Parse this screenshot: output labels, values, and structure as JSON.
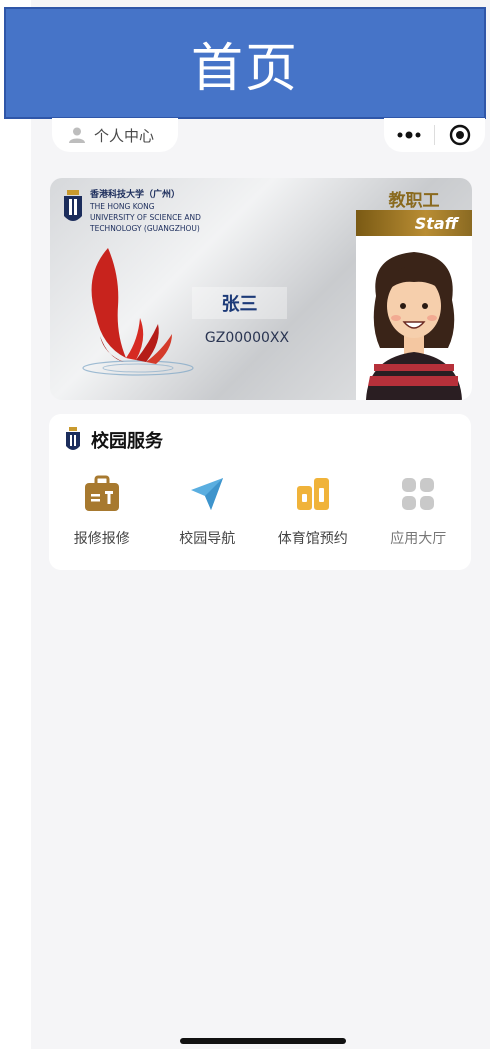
{
  "title_bar": {
    "title": "首页"
  },
  "nav": {
    "profile_label": "个人中心",
    "more_icon": "more-dots-icon",
    "target_icon": "target-icon"
  },
  "card": {
    "logo": {
      "cn": "香港科技大学（广州）",
      "en_line1": "THE HONG KONG",
      "en_line2": "UNIVERSITY OF SCIENCE AND",
      "en_line3": "TECHNOLOGY (GUANGZHOU)"
    },
    "name": "张三",
    "id_number": "GZ00000XX",
    "role": "教职工",
    "role_en": "Staff"
  },
  "services": {
    "title": "校园服务",
    "items": [
      {
        "label": "报修报修",
        "icon": "toolbox-icon",
        "color": "#a7792f"
      },
      {
        "label": "校园导航",
        "icon": "navigation-arrow-icon",
        "color": "#5aaee0"
      },
      {
        "label": "体育馆预约",
        "icon": "stadium-icon",
        "color": "#f0b33a"
      },
      {
        "label": "应用大厅",
        "icon": "app-grid-icon",
        "color": "#c9c9c9"
      }
    ]
  },
  "colors": {
    "title_bar": "#4674c8",
    "name_text": "#1c3a78",
    "staff_band": "#9b7426"
  }
}
